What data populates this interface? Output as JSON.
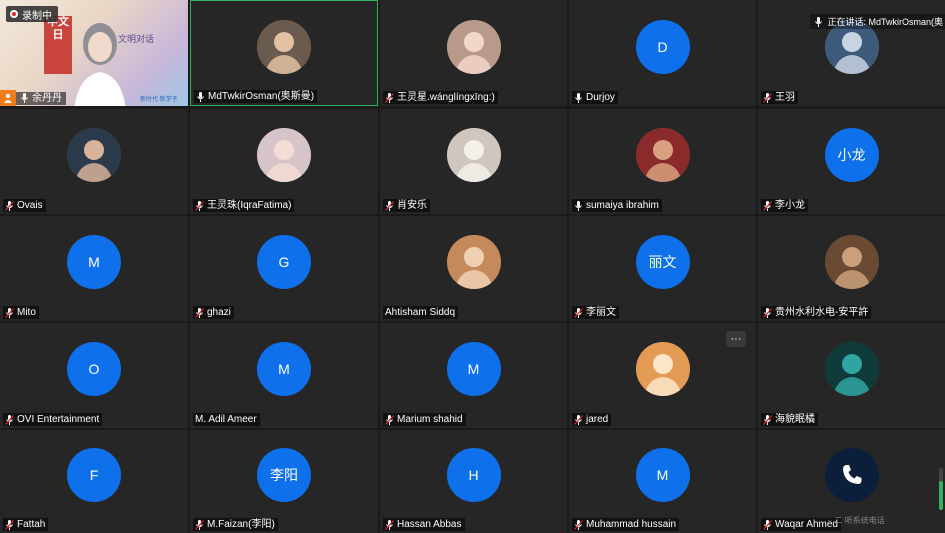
{
  "meeting": {
    "recording_label": "录制中",
    "speaking_label": "正在讲话: MdTwkirOsman(奥",
    "watermark": "·· 二 听系统电话",
    "volume_level": 0.7
  },
  "self_view": {
    "name": "余丹丹",
    "poster_text": "中文日",
    "banner_text": "文明对话",
    "banner_sub": "新时代 新学子"
  },
  "colors": {
    "avatar_blue": "#0e71eb",
    "active_border": "#2db55d",
    "tile_bg": "#262626"
  },
  "participants": [
    {
      "name": "MdTwkirOsman(奥斯曼)",
      "avatar_type": "photo",
      "mic": "on",
      "active": true
    },
    {
      "name": "王灵星.wánglíngxīng:)",
      "avatar_type": "photo",
      "mic": "muted"
    },
    {
      "name": "Durjoy",
      "avatar_type": "initial",
      "initial": "D",
      "mic": "on"
    },
    {
      "name": "王羽",
      "avatar_type": "photo",
      "mic": "muted"
    },
    {
      "name": "Ovais",
      "avatar_type": "photo",
      "mic": "muted"
    },
    {
      "name": "王灵珠(IqraFatima)",
      "avatar_type": "photo",
      "mic": "muted"
    },
    {
      "name": "肖安乐",
      "avatar_type": "photo",
      "mic": "muted"
    },
    {
      "name": "sumaiya ibrahim",
      "avatar_type": "photo",
      "mic": "on"
    },
    {
      "name": "李小龙",
      "avatar_type": "initial",
      "initial": "小龙",
      "mic": "muted"
    },
    {
      "name": "Mito",
      "avatar_type": "initial",
      "initial": "M",
      "mic": "muted"
    },
    {
      "name": "ghazi",
      "avatar_type": "initial",
      "initial": "G",
      "mic": "muted"
    },
    {
      "name": "Ahtisham Siddq",
      "avatar_type": "photo",
      "mic": "none"
    },
    {
      "name": "李丽文",
      "avatar_type": "initial",
      "initial": "丽文",
      "mic": "muted"
    },
    {
      "name": "贵州水利水电-安平許",
      "avatar_type": "photo",
      "mic": "muted"
    },
    {
      "name": "OVI Entertainment",
      "avatar_type": "initial",
      "initial": "O",
      "mic": "muted"
    },
    {
      "name": "M. Adil Ameer",
      "avatar_type": "initial",
      "initial": "M",
      "mic": "none"
    },
    {
      "name": "Marium shahid",
      "avatar_type": "initial",
      "initial": "M",
      "mic": "muted"
    },
    {
      "name": "jared",
      "avatar_type": "photo",
      "mic": "muted",
      "more_label": "···"
    },
    {
      "name": "海貌眠橘",
      "avatar_type": "photo",
      "mic": "muted"
    },
    {
      "name": "Fattah",
      "avatar_type": "initial",
      "initial": "F",
      "mic": "muted"
    },
    {
      "name": "M.Faizan(李阳)",
      "avatar_type": "initial",
      "initial": "李阳",
      "mic": "muted"
    },
    {
      "name": "Hassan Abbas",
      "avatar_type": "initial",
      "initial": "H",
      "mic": "muted"
    },
    {
      "name": "Muhammad hussain",
      "avatar_type": "initial",
      "initial": "M",
      "mic": "muted"
    },
    {
      "name": "Waqar Ahmed",
      "avatar_type": "phone",
      "mic": "muted"
    }
  ]
}
